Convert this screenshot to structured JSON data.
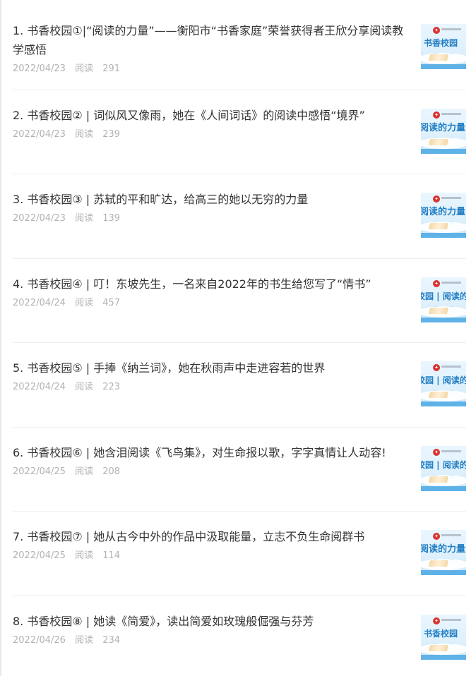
{
  "articles": [
    {
      "title": "1. 书香校园①|“阅读的力量”——衡阳市“书香家庭”荣誉获得者王欣分享阅读教学感悟",
      "date": "2022/04/23",
      "read_label": "阅读",
      "read_count": "291",
      "thumbnail_text": "书香校园"
    },
    {
      "title": "2. 书香校园② | 词似风又像雨，她在《人间词话》的阅读中感悟“境界”",
      "date": "2022/04/23",
      "read_label": "阅读",
      "read_count": "239",
      "thumbnail_text": "阅读的力量"
    },
    {
      "title": "3. 书香校园③ | 苏轼的平和旷达，给高三的她以无穷的力量",
      "date": "2022/04/23",
      "read_label": "阅读",
      "read_count": "139",
      "thumbnail_text": "阅读的力量"
    },
    {
      "title": "4. 书香校园④ | 叮！东坡先生，一名来自2022年的书生给您写了“情书”",
      "date": "2022/04/24",
      "read_label": "阅读",
      "read_count": "457",
      "thumbnail_text": "校园 | 阅读的"
    },
    {
      "title": "5. 书香校园⑤ | 手捧《纳兰词》，她在秋雨声中走进容若的世界",
      "date": "2022/04/24",
      "read_label": "阅读",
      "read_count": "223",
      "thumbnail_text": "校园 | 阅读的"
    },
    {
      "title": "6. 书香校园⑥ | 她含泪阅读《飞鸟集》，对生命报以歌，字字真情让人动容!",
      "date": "2022/04/25",
      "read_label": "阅读",
      "read_count": "208",
      "thumbnail_text": "校园 | 阅读的"
    },
    {
      "title": "7. 书香校园⑦ | 她从古今中外的作品中汲取能量，立志不负生命阅群书",
      "date": "2022/04/25",
      "read_label": "阅读",
      "read_count": "114",
      "thumbnail_text": "阅读的力量"
    },
    {
      "title": "8. 书香校园⑧ | 她读《简爱》，读出简爱如玫瑰般倔强与芬芳",
      "date": "2022/04/26",
      "read_label": "阅读",
      "read_count": "234",
      "thumbnail_text": "书香校园"
    }
  ],
  "colors": {
    "title": "#333333",
    "meta": "#b2b2b2",
    "divider": "#eeeeee",
    "thumbnail_text": "#237fc5"
  },
  "icons": {
    "thumbnail_badge": "school-badge-icon",
    "thumbnail_book": "open-book-icon"
  }
}
